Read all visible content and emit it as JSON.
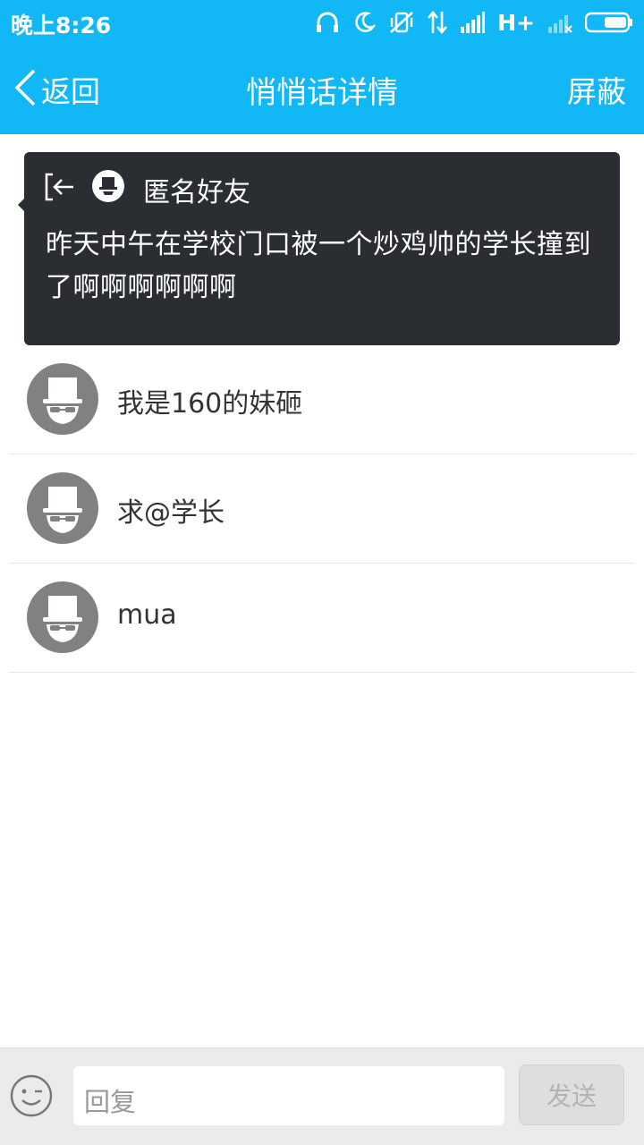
{
  "status_bar": {
    "time": "晚上8:26",
    "network": "H+",
    "icons": [
      "headphones-icon",
      "moon-icon",
      "vibrate-off-icon",
      "data-transfer-icon",
      "signal-icon",
      "signal-weak-icon",
      "battery-icon"
    ]
  },
  "header": {
    "back_label": "返回",
    "title": "悄悄话详情",
    "block_label": "屏蔽"
  },
  "whisper": {
    "author": "匿名好友",
    "content": "昨天中午在学校门口被一个炒鸡帅的学长撞到了啊啊啊啊啊啊"
  },
  "replies": [
    {
      "text": "我是160的妹砸"
    },
    {
      "text": "求@学长"
    },
    {
      "text": "mua"
    }
  ],
  "input_bar": {
    "placeholder": "回复",
    "send_label": "发送"
  },
  "colors": {
    "accent": "#12b7f5",
    "card": "#2a2e33",
    "avatar": "#828083"
  }
}
